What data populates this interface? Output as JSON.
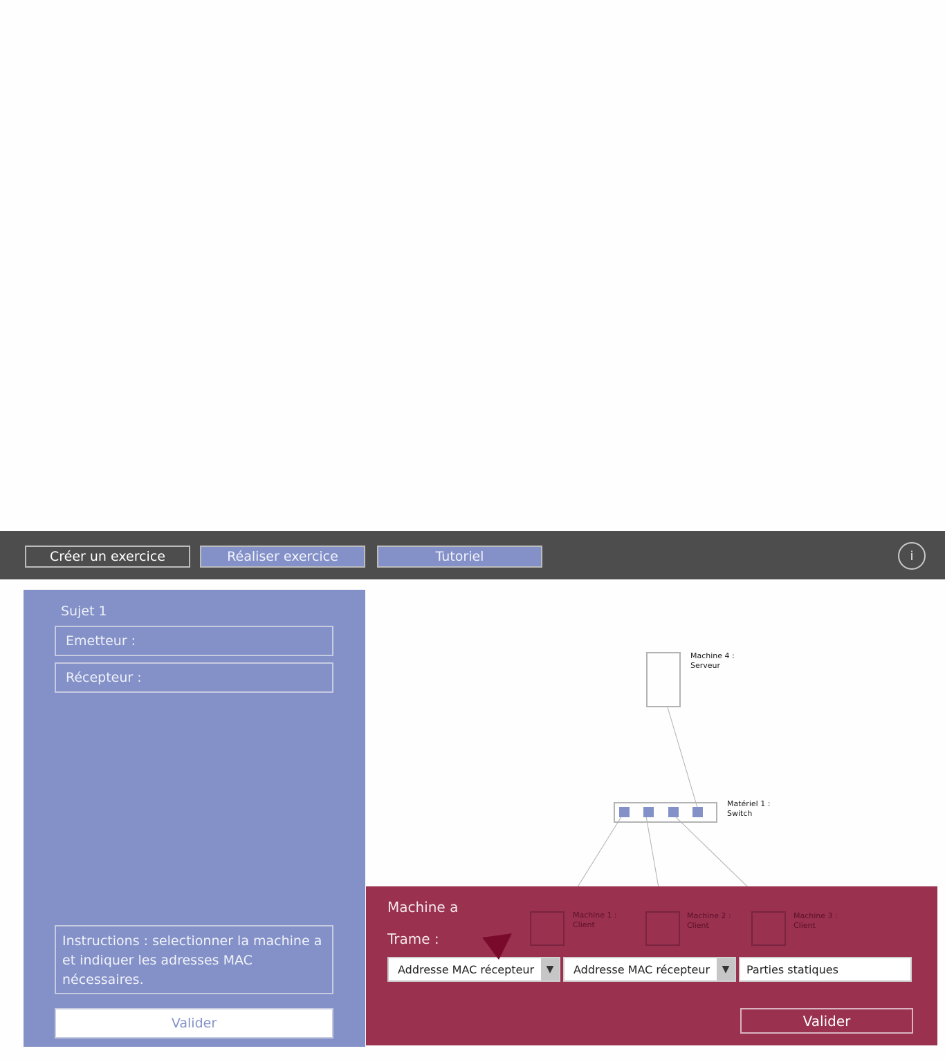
{
  "nav": {
    "create_label": "Créer un exercice",
    "do_label": "Réaliser exercice",
    "tutorial_label": "Tutoriel",
    "info_label": "i"
  },
  "left_panel": {
    "subject": "Sujet 1",
    "sender": "Emetteur :",
    "receiver": "Récepteur :",
    "instructions": "Instructions : selectionner la machine a et indiquer les adresses MAC nécessaires.",
    "validate": "Valider"
  },
  "diagram": {
    "server": "Machine 4 :\nServeur",
    "switch": "Matériel 1 :\nSwitch",
    "client1": "Machine 1 :\nClient",
    "client2": "Machine 2 :\nClient",
    "client3": "Machine 3 :\nClient"
  },
  "machine_panel": {
    "title": "Machine a",
    "frame_label": "Trame :",
    "select1": "Addresse MAC récepteur",
    "select2": "Addresse MAC récepteur",
    "static_parts": "Parties statiques",
    "validate": "Valider",
    "arrow_glyph": "▼"
  },
  "colors": {
    "topbar": "#4d4d4d",
    "blue_accent": "#8391c8",
    "machine_panel": "#99314f",
    "cursor_marker": "#7a0a2c"
  }
}
